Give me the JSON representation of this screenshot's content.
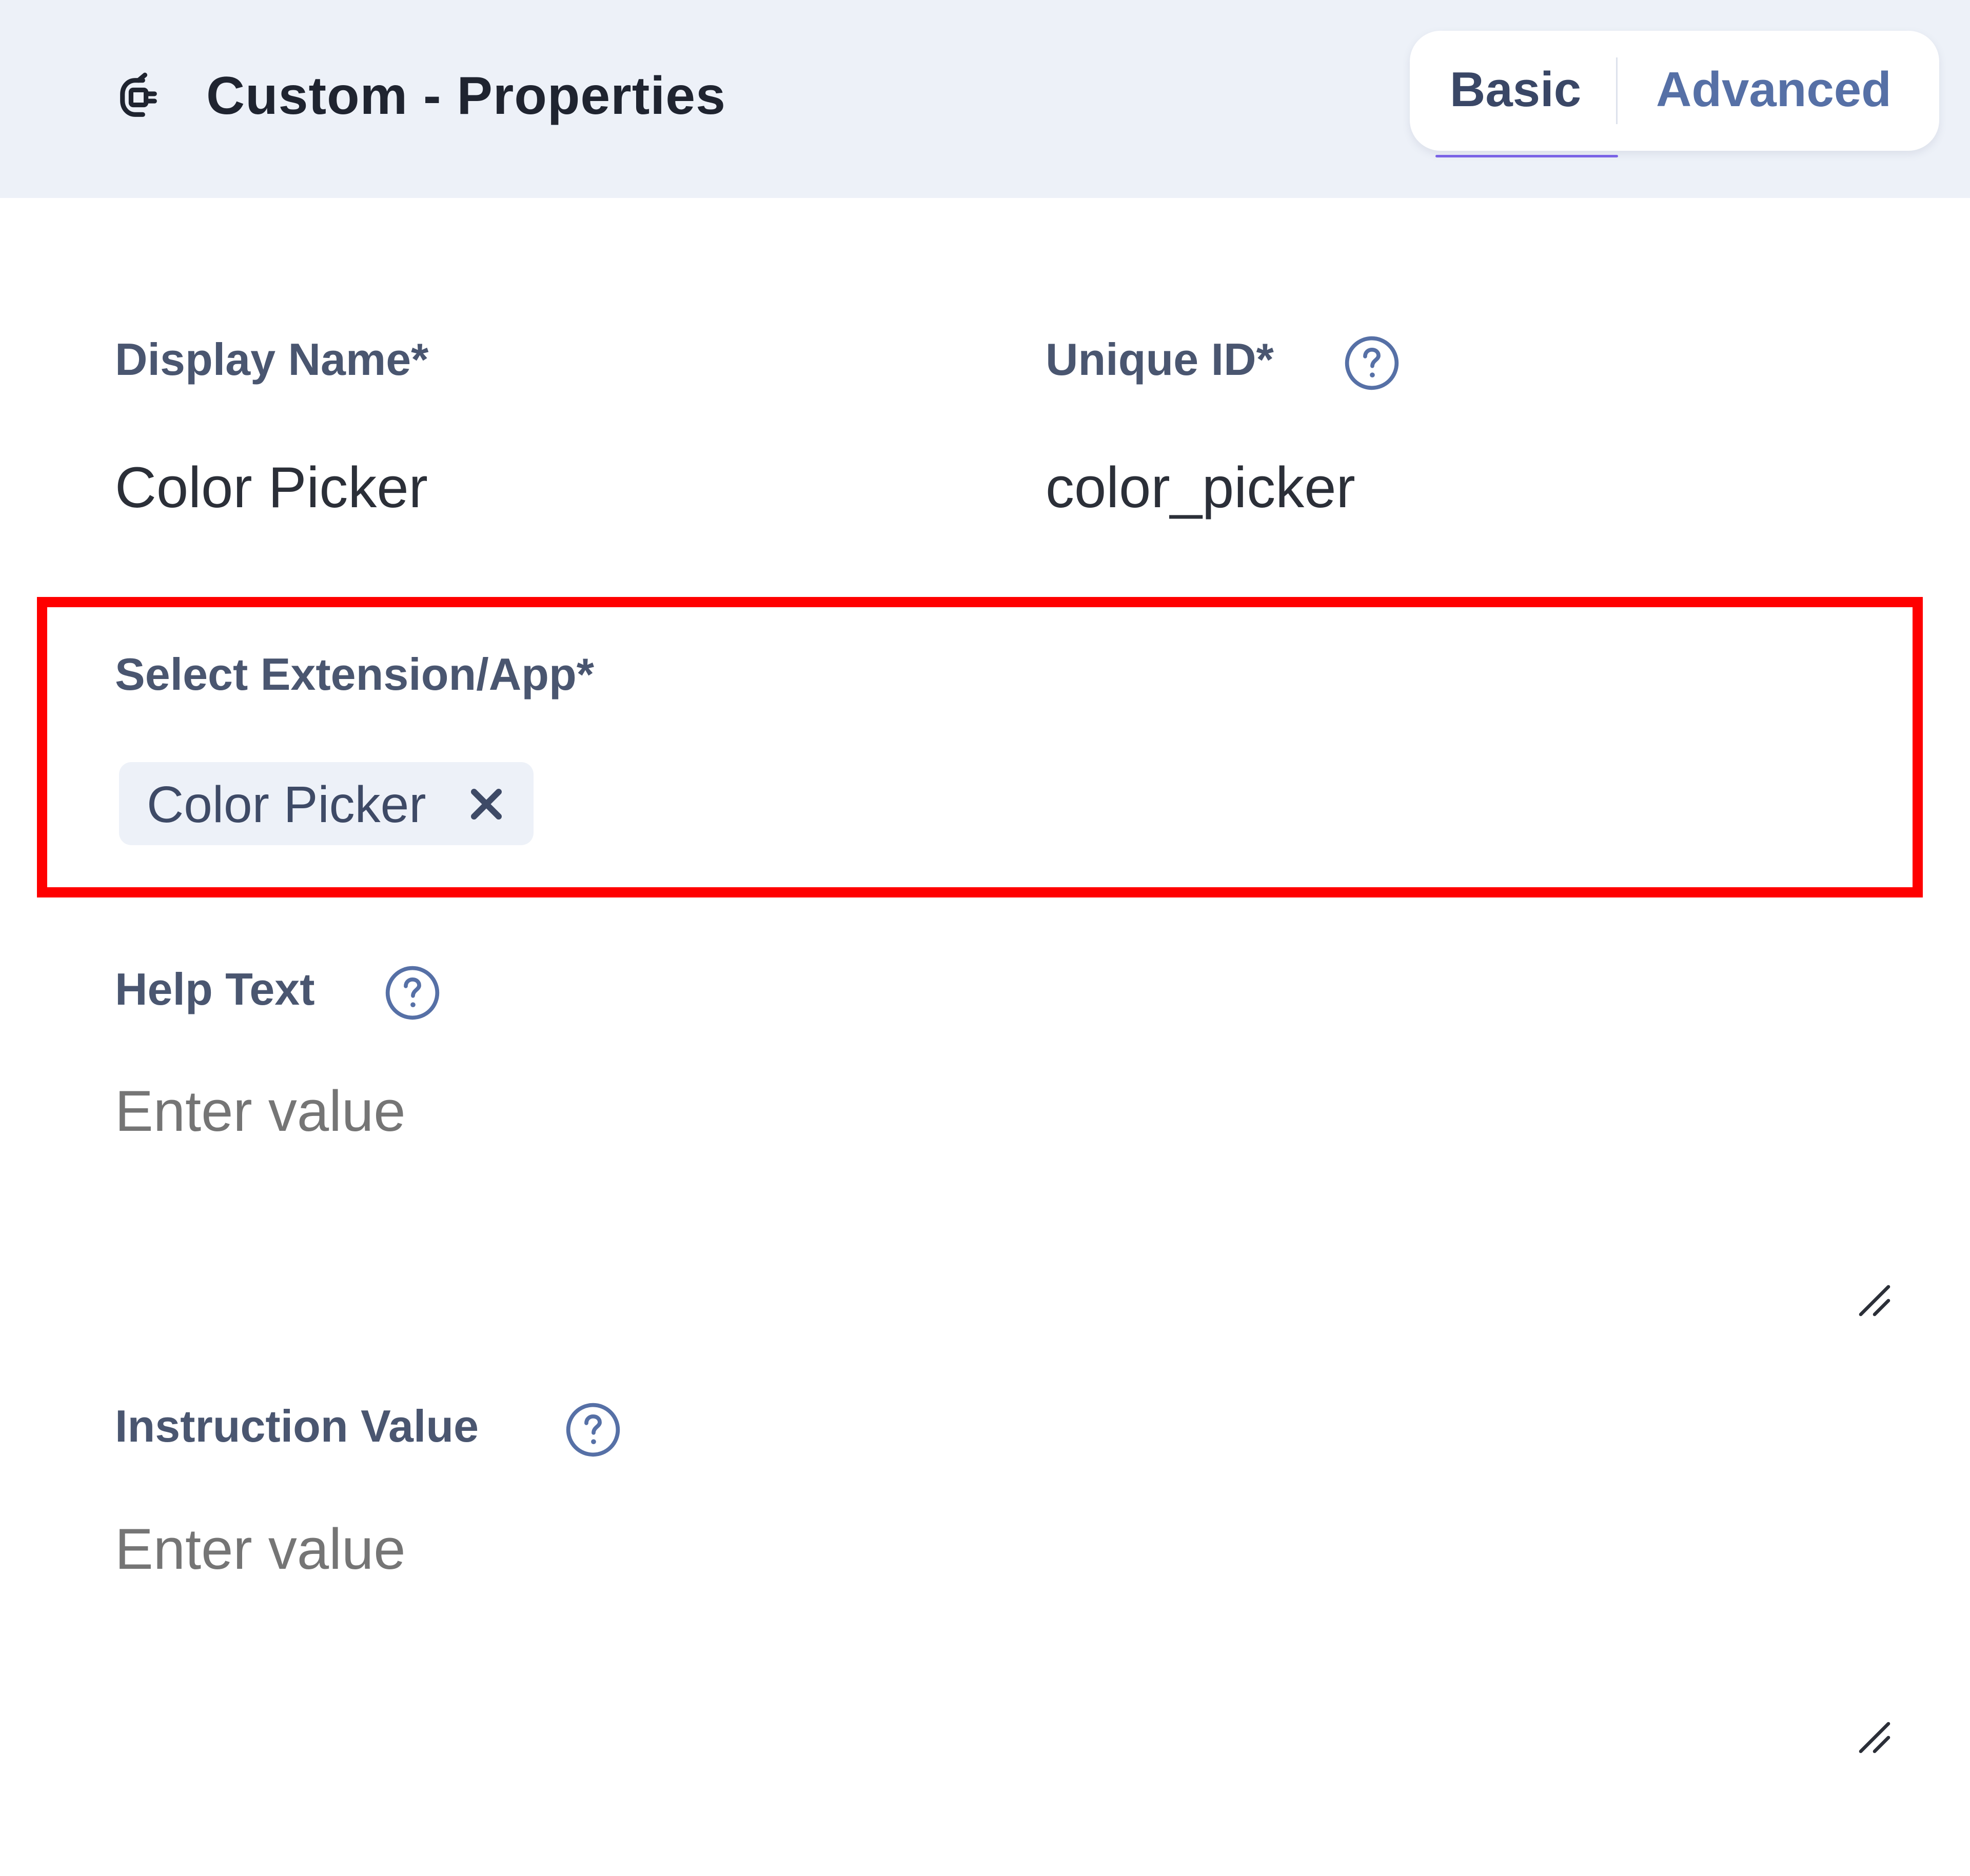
{
  "header": {
    "title": "Custom - Properties",
    "icon": "plug-icon",
    "tabs": [
      {
        "label": "Basic",
        "active": true
      },
      {
        "label": "Advanced",
        "active": false
      }
    ]
  },
  "fields": {
    "display_name": {
      "label": "Display Name*",
      "value": "Color Picker"
    },
    "unique_id": {
      "label": "Unique ID*",
      "value": "color_picker",
      "help_icon": "help-circle-icon"
    },
    "extension": {
      "label": "Select Extension/App*",
      "selected": [
        {
          "label": "Color Picker"
        }
      ]
    },
    "help_text": {
      "label": "Help Text",
      "placeholder": "Enter value",
      "help_icon": "help-circle-icon"
    },
    "instruction_value": {
      "label": "Instruction Value",
      "placeholder": "Enter value",
      "help_icon": "help-circle-icon"
    }
  },
  "colors": {
    "header_bg": "#edf1f8",
    "accent": "#7a63e6",
    "highlight": "#ff0000",
    "label": "#4a5670",
    "placeholder": "#6f85ad"
  }
}
